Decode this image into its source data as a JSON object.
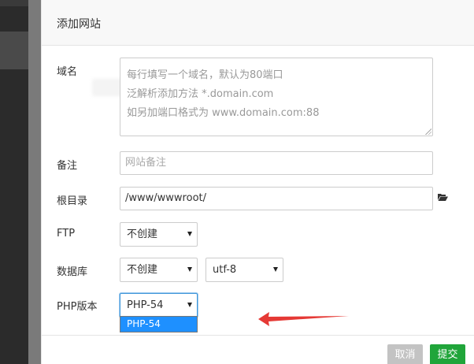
{
  "dialog": {
    "title": "添加网站"
  },
  "form": {
    "domain": {
      "label": "域名",
      "placeholder_lines": [
        "每行填写一个域名，默认为80端口",
        "泛解析添加方法 *.domain.com",
        "如另加端口格式为 www.domain.com:88"
      ]
    },
    "remark": {
      "label": "备注",
      "placeholder": "网站备注"
    },
    "root": {
      "label": "根目录",
      "value": "/www/wwwroot/",
      "icon": "folder-open-icon"
    },
    "ftp": {
      "label": "FTP",
      "value": "不创建"
    },
    "database": {
      "label": "数据库",
      "value": "不创建",
      "charset": "utf-8"
    },
    "php": {
      "label": "PHP版本",
      "value": "PHP-54",
      "dropdown_options": [
        "PHP-54"
      ]
    }
  },
  "footer": {
    "cancel_label": "取消",
    "submit_label": "提交"
  },
  "colors": {
    "submit": "#20a53a",
    "cancel": "#c3c3c3",
    "dropdown_highlight": "#1e90ff",
    "annotation_arrow": "#e53935"
  }
}
